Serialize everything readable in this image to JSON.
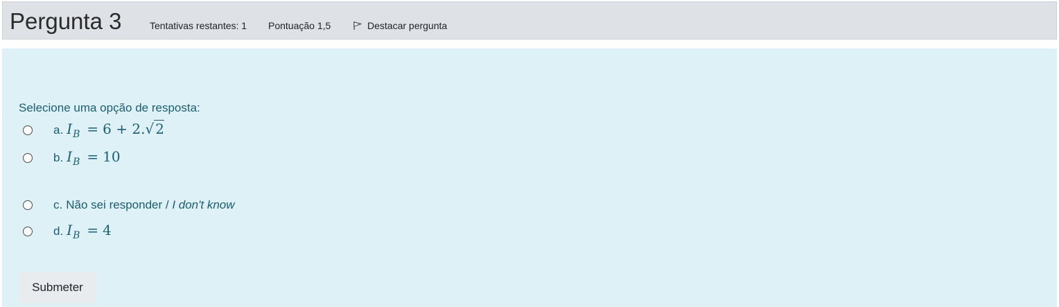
{
  "header": {
    "title": "Pergunta 3",
    "attempts": "Tentativas restantes: 1",
    "score": "Pontuação 1,5",
    "flag_label": "Destacar pergunta",
    "flag_icon": "flag-icon"
  },
  "question": {
    "prompt": "Selecione uma opção de resposta:",
    "options": [
      {
        "letter": "a.",
        "var": "I",
        "sub": "B",
        "eq": "=",
        "expr_prefix": "6 + 2.",
        "sqrt_symbol": "√",
        "sqrt_arg": "2"
      },
      {
        "letter": "b.",
        "var": "I",
        "sub": "B",
        "eq": "=",
        "value": "10"
      },
      {
        "letter": "c.",
        "text": "Não sei responder / ",
        "text_italic": "I don't know"
      },
      {
        "letter": "d.",
        "var": "I",
        "sub": "B",
        "eq": "=",
        "value": "4"
      }
    ]
  },
  "actions": {
    "submit_label": "Submeter"
  },
  "colors": {
    "header_bg": "#dee2e6",
    "content_bg": "#def1f7",
    "content_text": "#1c5d72",
    "button_bg": "#e9ecef"
  }
}
